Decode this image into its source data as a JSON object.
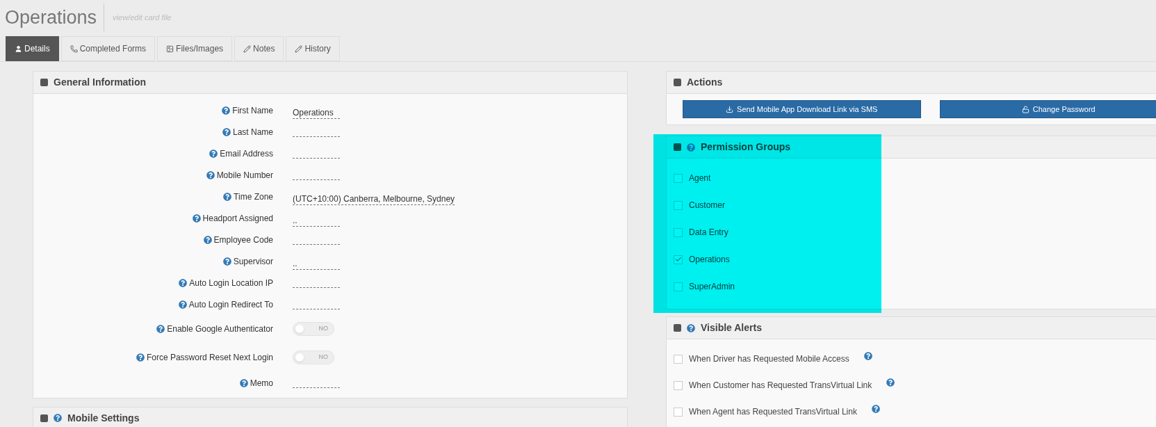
{
  "page": {
    "title": "Operations",
    "subtitle": "view/edit card file"
  },
  "tabs": [
    {
      "label": "Details",
      "selected": true
    },
    {
      "label": "Completed Forms",
      "selected": false
    },
    {
      "label": "Files/Images",
      "selected": false
    },
    {
      "label": "Notes",
      "selected": false
    },
    {
      "label": "History",
      "selected": false
    }
  ],
  "general_information": {
    "title": "General Information",
    "fields": [
      {
        "kind": "text",
        "label": "First Name",
        "value": "Operations"
      },
      {
        "kind": "text",
        "label": "Last Name"
      },
      {
        "kind": "text",
        "label": "Email Address"
      },
      {
        "kind": "text",
        "label": "Mobile Number"
      },
      {
        "kind": "text",
        "label": "Time Zone",
        "value": "(UTC+10:00) Canberra, Melbourne, Sydney"
      },
      {
        "kind": "text",
        "label": "Headport Assigned",
        "value": ".."
      },
      {
        "kind": "text",
        "label": "Employee Code"
      },
      {
        "kind": "text",
        "label": "Supervisor",
        "value": ".."
      },
      {
        "kind": "text",
        "label": "Auto Login Location IP"
      },
      {
        "kind": "text",
        "label": "Auto Login Redirect To"
      },
      {
        "kind": "toggle",
        "label": "Enable Google Authenticator",
        "on": false,
        "value": "NO"
      },
      {
        "kind": "toggle",
        "label": "Force Password Reset Next Login",
        "on": false,
        "value": "NO"
      },
      {
        "kind": "text",
        "label": "Memo"
      }
    ]
  },
  "mobile_settings": {
    "title": "Mobile Settings"
  },
  "actions": {
    "title": "Actions",
    "buttons": [
      {
        "label": "Send Mobile App Download Link via SMS"
      },
      {
        "label": "Change Password"
      }
    ]
  },
  "permission_groups": {
    "title": "Permission Groups",
    "highlighted": true,
    "items": [
      {
        "label": "Agent",
        "checked": false
      },
      {
        "label": "Customer",
        "checked": false
      },
      {
        "label": "Data Entry",
        "checked": false
      },
      {
        "label": "Operations",
        "checked": true
      },
      {
        "label": "SuperAdmin",
        "checked": false
      }
    ]
  },
  "visible_alerts": {
    "title": "Visible Alerts",
    "items": [
      {
        "label": "When Driver has Requested Mobile Access",
        "checked": false
      },
      {
        "label": "When Customer has Requested TransVirtual Link",
        "checked": false
      },
      {
        "label": "When Agent has Requested TransVirtual Link",
        "checked": false
      }
    ]
  }
}
